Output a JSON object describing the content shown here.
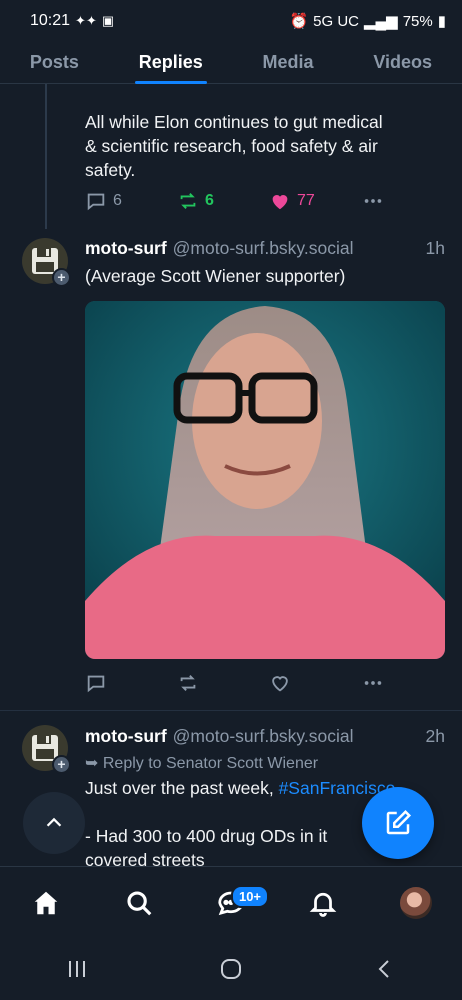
{
  "status_bar": {
    "time": "10:21",
    "network": "5G UC",
    "battery": "75%"
  },
  "tabs": [
    {
      "label": "Posts",
      "active": false
    },
    {
      "label": "Replies",
      "active": true
    },
    {
      "label": "Media",
      "active": false
    },
    {
      "label": "Videos",
      "active": false
    }
  ],
  "post1": {
    "text_line1": "All while Elon continues to gut medical",
    "text_line2": "& scientific research, food safety & air",
    "text_line3": "safety.",
    "replies": "6",
    "reposts": "6",
    "likes": "77"
  },
  "post2": {
    "author": "moto-surf",
    "handle": "@moto-surf.bsky.social",
    "time": "1h",
    "text": "(Average Scott Wiener supporter)"
  },
  "post3": {
    "author": "moto-surf",
    "handle": "@moto-surf.bsky.social",
    "time": "2h",
    "reply_to": "Reply to Senator Scott Wiener",
    "text_line1_prefix": "Just over the past week, ",
    "text_line1_hashtag": "#SanFrancisco",
    "text_line2": "- Had 300 to 400 drug ODs in it",
    "text_line3": "covered streets"
  },
  "nav": {
    "badge": "10+"
  },
  "colors": {
    "accent": "#1083fe",
    "like": "#ec4899",
    "repost": "#22c55e",
    "background": "#151d28"
  }
}
